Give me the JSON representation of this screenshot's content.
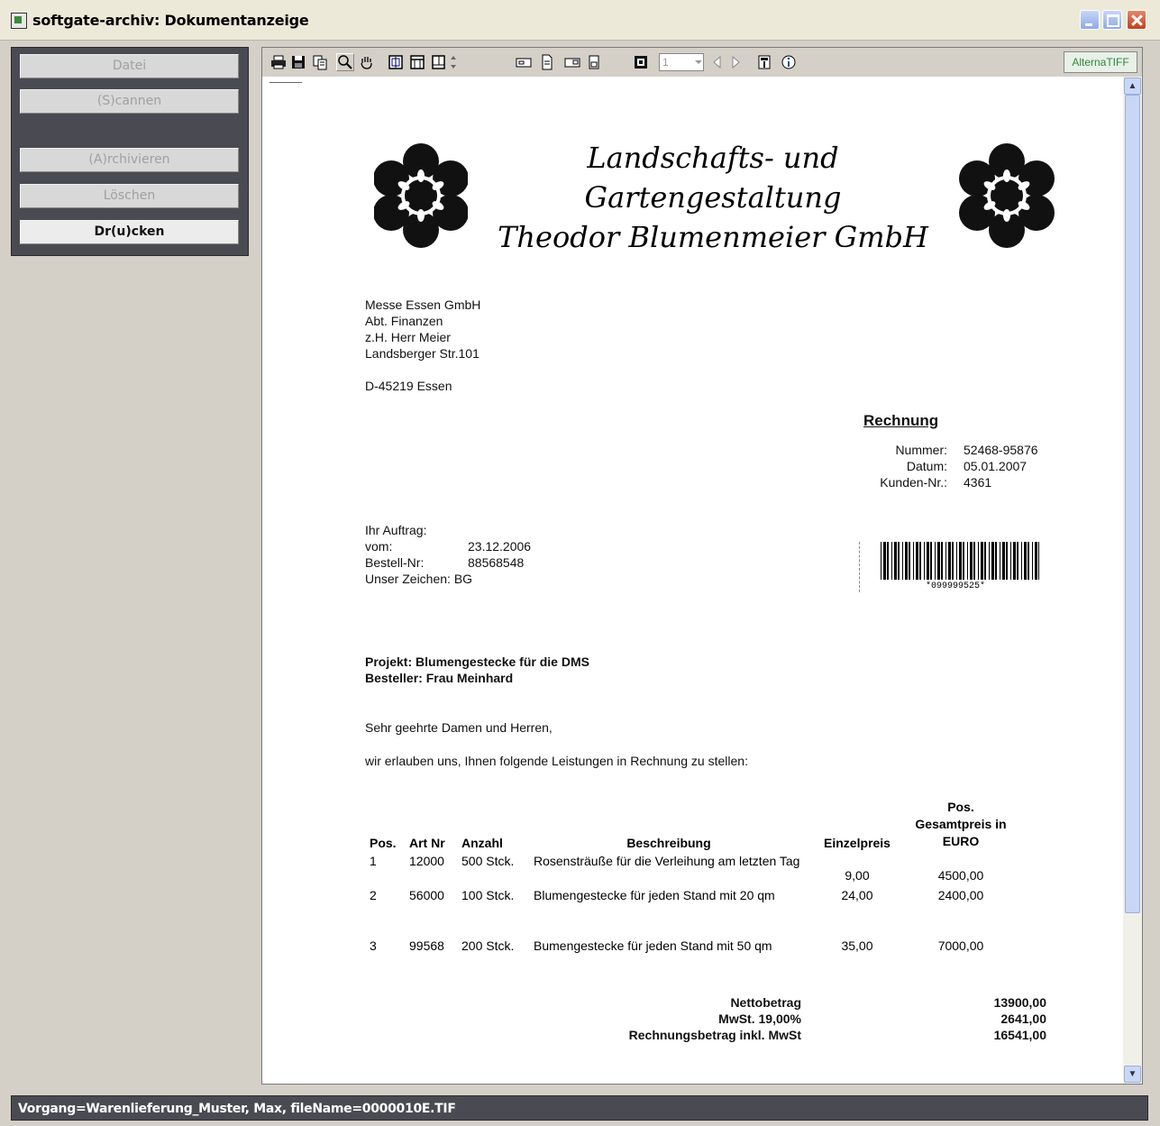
{
  "window": {
    "title": "softgate-archiv: Dokumentanzeige"
  },
  "sidebar": {
    "buttons": [
      {
        "label": "Datei",
        "enabled": false
      },
      {
        "label": "(S)cannen",
        "enabled": false
      },
      {
        "label": "(A)rchivieren",
        "enabled": false
      },
      {
        "label": "Löschen",
        "enabled": false
      },
      {
        "label": "Dr(u)cken",
        "enabled": true
      }
    ]
  },
  "toolbar": {
    "icons": [
      "printer-icon",
      "save-icon",
      "copy-icon",
      "zoom-icon",
      "hand-icon",
      "fit-page-icon",
      "fit-width-icon",
      "fit-height-icon",
      "zoom-spin-icon",
      "thumbnail-icon",
      "single-page-icon",
      "two-page-icon",
      "page-icon",
      "bw-icon"
    ],
    "page_number": "1",
    "brand": "AlternaTIFF"
  },
  "document": {
    "company_line1": "Landschafts- und Gartengestaltung",
    "company_line2": "Theodor Blumenmeier GmbH",
    "recipient": [
      "Messe Essen GmbH",
      "Abt. Finanzen",
      "z.H. Herr Meier",
      "Landsberger Str.101"
    ],
    "recipient_city": "D-45219 Essen",
    "invoice_heading": "Rechnung",
    "invoice_meta": [
      {
        "label": "Nummer:",
        "value": "52468-95876"
      },
      {
        "label": "Datum:",
        "value": "05.01.2007"
      },
      {
        "label": "Kunden-Nr.:",
        "value": "4361"
      }
    ],
    "order": {
      "heading": "Ihr Auftrag:",
      "vom_label": "vom:",
      "vom_value": "23.12.2006",
      "bestell_label": "Bestell-Nr:",
      "bestell_value": "88568548",
      "zeichen_label": "Unser Zeichen:",
      "zeichen_value": "BG"
    },
    "barcode_text": "*099999525*",
    "project": "Projekt: Blumengestecke für die DMS",
    "orderer": "Besteller: Frau Meinhard",
    "salutation": "Sehr geehrte Damen und Herren,",
    "intro": "wir erlauben uns, Ihnen folgende Leistungen in Rechnung zu stellen:",
    "table_headers": {
      "pos": "Pos.",
      "art": "Art Nr",
      "anzahl": "Anzahl",
      "beschreibung": "Beschreibung",
      "einzel": "Einzelpreis",
      "gesamt": "Pos. Gesamtpreis in EURO"
    },
    "items": [
      {
        "pos": "1",
        "art": "12000",
        "anzahl": "500 Stck.",
        "beschreibung": "Rosensträuße für die Verleihung am letzten Tag",
        "einzel": "9,00",
        "gesamt": "4500,00"
      },
      {
        "pos": "2",
        "art": "56000",
        "anzahl": "100 Stck.",
        "beschreibung": "Blumengestecke für jeden Stand mit 20 qm",
        "einzel": "24,00",
        "gesamt": "2400,00"
      },
      {
        "pos": "3",
        "art": "99568",
        "anzahl": "200 Stck.",
        "beschreibung": "Bumengestecke für jeden Stand mit 50 qm",
        "einzel": "35,00",
        "gesamt": "7000,00"
      }
    ],
    "totals": [
      {
        "label": "Nettobetrag",
        "value": "13900,00"
      },
      {
        "label": "MwSt. 19,00%",
        "value": "2641,00"
      },
      {
        "label": "Rechnungsbetrag inkl. MwSt",
        "value": "16541,00"
      }
    ]
  },
  "status": {
    "text": "Vorgang=Warenlieferung_Muster, Max, fileName=0000010E.TIF"
  }
}
